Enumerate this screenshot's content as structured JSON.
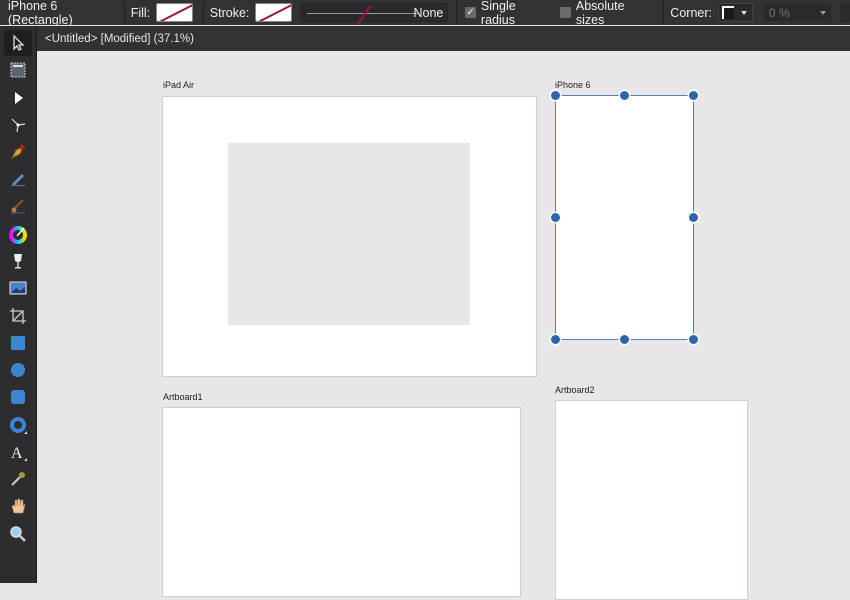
{
  "context_toolbar": {
    "selection_title": "iPhone 6 (Rectangle)",
    "fill_label": "Fill:",
    "stroke_label": "Stroke:",
    "stroke_style_value": "None",
    "single_radius": {
      "label": "Single radius",
      "checked": true,
      "glyph": "✓"
    },
    "absolute_sizes": {
      "label": "Absolute sizes",
      "checked": false
    },
    "corner_label": "Corner:",
    "corner_percent": "0 %",
    "accent_none_color": "#a0153e"
  },
  "document_tab": {
    "title": "<Untitled> [Modified] (37.1%)"
  },
  "tools": [
    {
      "name": "move-tool",
      "active": true
    },
    {
      "name": "artboard-tool"
    },
    {
      "name": "node-tool"
    },
    {
      "name": "corner-tool"
    },
    {
      "name": "pen-tool"
    },
    {
      "name": "pencil-tool"
    },
    {
      "name": "vector-brush-tool"
    },
    {
      "name": "fill-tool"
    },
    {
      "name": "transparency-tool"
    },
    {
      "name": "place-image-tool"
    },
    {
      "name": "crop-tool"
    },
    {
      "name": "rectangle-tool"
    },
    {
      "name": "ellipse-tool"
    },
    {
      "name": "rounded-rectangle-tool"
    },
    {
      "name": "donut-tool"
    },
    {
      "name": "text-tool"
    },
    {
      "name": "color-picker-tool"
    },
    {
      "name": "view-tool"
    },
    {
      "name": "zoom-tool"
    }
  ],
  "artboards": [
    {
      "name": "iPad Air"
    },
    {
      "name": "iPhone 6",
      "selected": true
    },
    {
      "name": "Artboard1"
    },
    {
      "name": "Artboard2"
    }
  ],
  "selection_color": "#2f64ad"
}
